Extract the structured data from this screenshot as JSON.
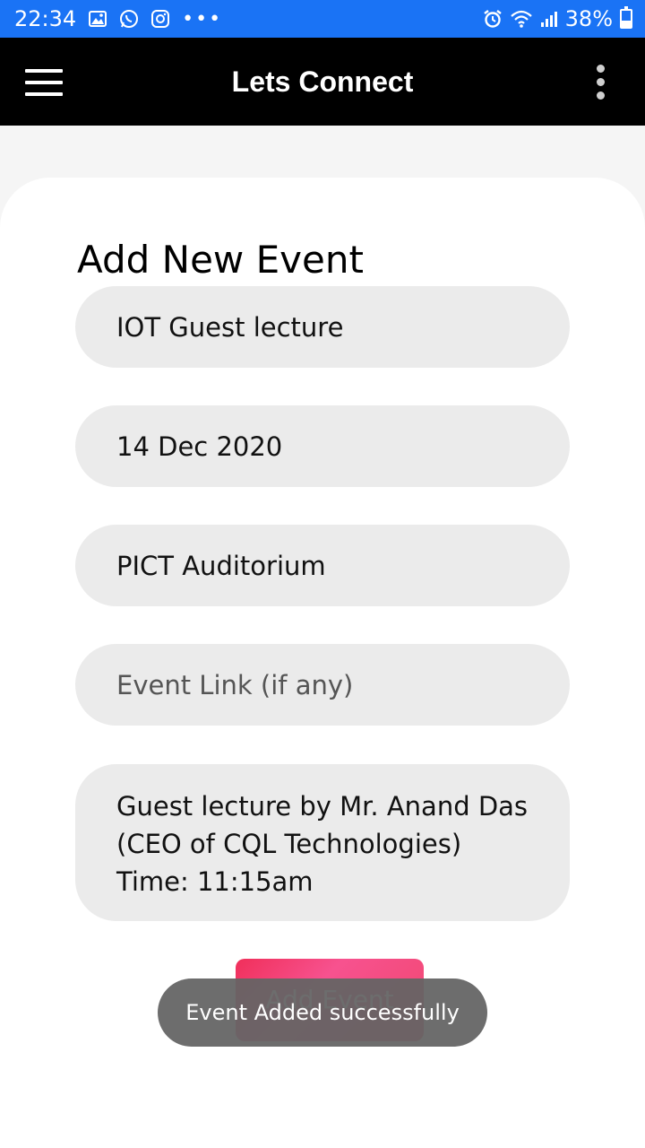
{
  "status_bar": {
    "time": "22:34",
    "battery": "38%",
    "icons": [
      "gallery-icon",
      "whatsapp-icon",
      "instagram-icon",
      "more-notifications-icon",
      "alarm-icon",
      "wifi-icon",
      "signal-icon",
      "battery-icon"
    ],
    "more": "•••"
  },
  "app_bar": {
    "title": "Lets Connect",
    "background": "#000000"
  },
  "form": {
    "title": "Add New Event",
    "fields": [
      {
        "value": "IOT Guest lecture"
      },
      {
        "value": "14 Dec 2020"
      },
      {
        "value": "PICT Auditorium"
      },
      {
        "placeholder": "Event Link (if any)",
        "value": ""
      },
      {
        "lines": [
          "Guest lecture by Mr. Anand Das",
          "(CEO of CQL Technologies)",
          "Time: 11:15am"
        ]
      }
    ],
    "submit_label": "Add Event",
    "accent": "#f24a7a"
  },
  "toast": {
    "message": "Event Added successfully"
  },
  "colors": {
    "status_bar": "#1a73f5",
    "field_bg": "#ebebeb"
  }
}
